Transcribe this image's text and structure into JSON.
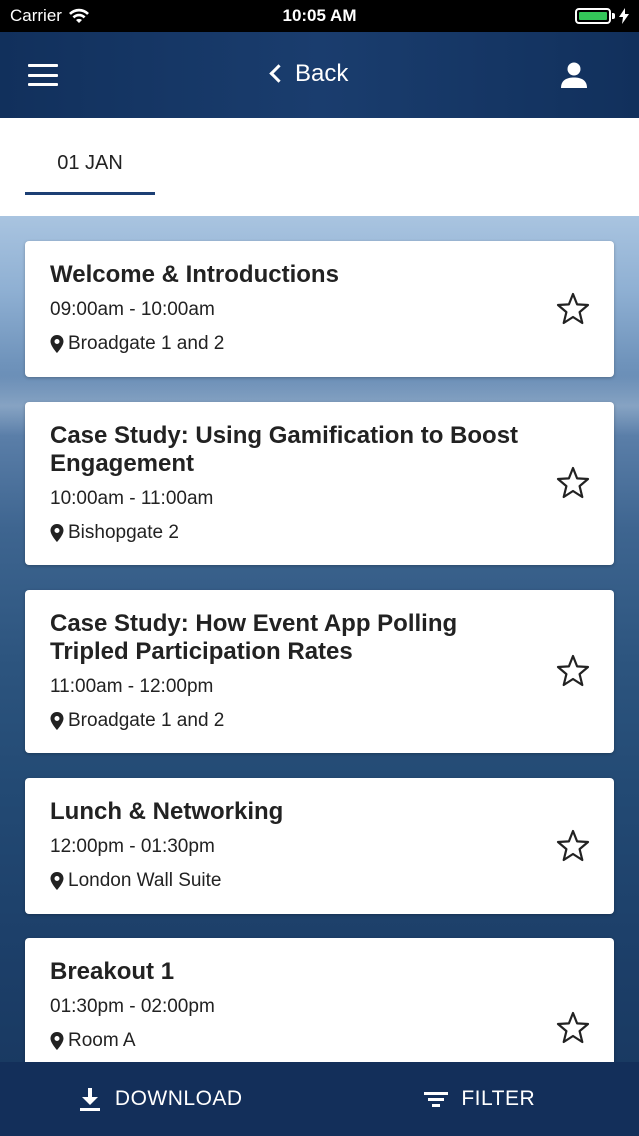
{
  "status": {
    "carrier": "Carrier",
    "time": "10:05 AM",
    "battery_color": "#34c759"
  },
  "nav": {
    "back_label": "Back",
    "menu_icon": "hamburger-icon",
    "user_icon": "user-icon"
  },
  "tabs": [
    {
      "label": "01 JAN",
      "selected": true
    }
  ],
  "sessions": [
    {
      "title": "Welcome & Introductions",
      "time": "09:00am - 10:00am",
      "location": "Broadgate 1 and 2"
    },
    {
      "title": "Case Study: Using Gamification to Boost Engagement",
      "time": "10:00am - 11:00am",
      "location": "Bishopgate 2"
    },
    {
      "title": "Case Study: How Event App Polling Tripled Participation Rates",
      "time": "11:00am - 12:00pm",
      "location": "Broadgate 1 and 2"
    },
    {
      "title": "Lunch & Networking",
      "time": "12:00pm - 01:30pm",
      "location": "London Wall Suite"
    },
    {
      "title": "Breakout 1",
      "time": "01:30pm - 02:00pm",
      "location": "Room A"
    }
  ],
  "bottom": {
    "download_label": "DOWNLOAD",
    "filter_label": "FILTER"
  },
  "colors": {
    "nav_bg": "#1a3d6e",
    "accent": "#1c3f74",
    "bottom_bg": "#132f5a"
  }
}
